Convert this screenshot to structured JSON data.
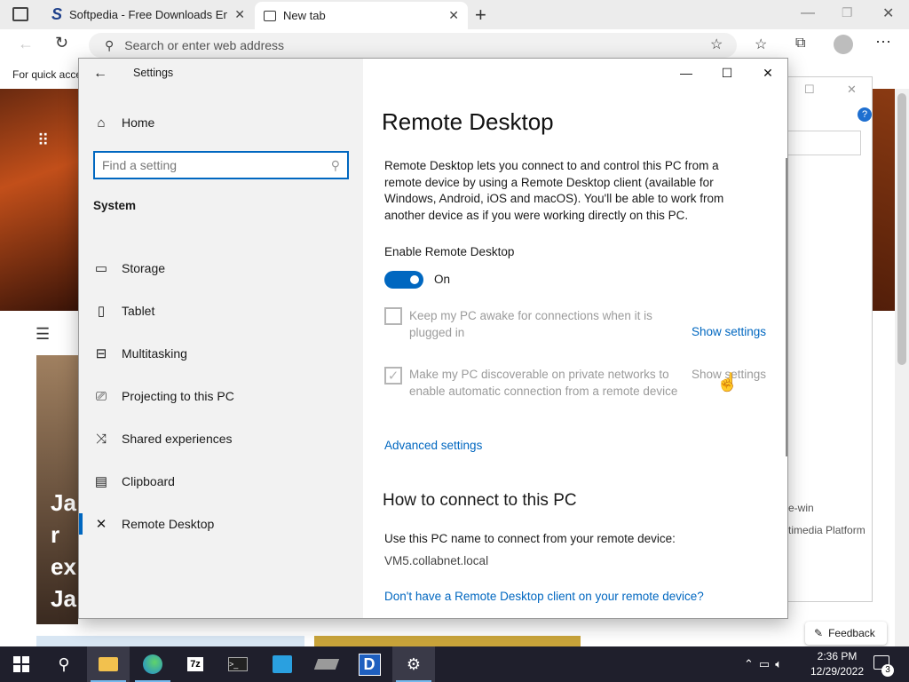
{
  "browser": {
    "tab1_title": "Softpedia - Free Downloads Ency",
    "tab2_title": "New tab",
    "address_placeholder": "Search or enter web address",
    "favbar_text": "For quick acce"
  },
  "background_page": {
    "card_text": "Jar ex Jar",
    "feedback_label": "Feedback",
    "side_text_1": "e-win",
    "side_text_2": "timedia Platform"
  },
  "settings": {
    "window_title": "Settings",
    "home_label": "Home",
    "search_placeholder": "Find a setting",
    "section_label": "System",
    "nav": [
      {
        "label": "Storage",
        "icon": "storage-icon"
      },
      {
        "label": "Tablet",
        "icon": "tablet-icon"
      },
      {
        "label": "Multitasking",
        "icon": "multitasking-icon"
      },
      {
        "label": "Projecting to this PC",
        "icon": "projecting-icon"
      },
      {
        "label": "Shared experiences",
        "icon": "shared-experiences-icon"
      },
      {
        "label": "Clipboard",
        "icon": "clipboard-icon"
      },
      {
        "label": "Remote Desktop",
        "icon": "remote-desktop-icon"
      }
    ],
    "selected_nav": "Remote Desktop",
    "page_title": "Remote Desktop",
    "description": "Remote Desktop lets you connect to and control this PC from a remote device by using a Remote Desktop client (available for Windows, Android, iOS and macOS). You'll be able to work from another device as if you were working directly on this PC.",
    "enable_label": "Enable Remote Desktop",
    "toggle_state": "On",
    "option1_text": "Keep my PC awake for connections when it is plugged in",
    "option1_checked": false,
    "option2_text": "Make my PC discoverable on private networks to enable automatic connection from a remote device",
    "option2_checked": true,
    "show_settings_label": "Show settings",
    "advanced_link": "Advanced settings",
    "connect_heading": "How to connect to this PC",
    "connect_text": "Use this PC name to connect from your remote device:",
    "pc_name": "VM5.collabnet.local",
    "client_link": "Don't have a Remote Desktop client on your remote device?"
  },
  "taskbar": {
    "time": "2:36 PM",
    "date": "12/29/2022",
    "notification_count": "3",
    "accent": "#0067c0"
  }
}
